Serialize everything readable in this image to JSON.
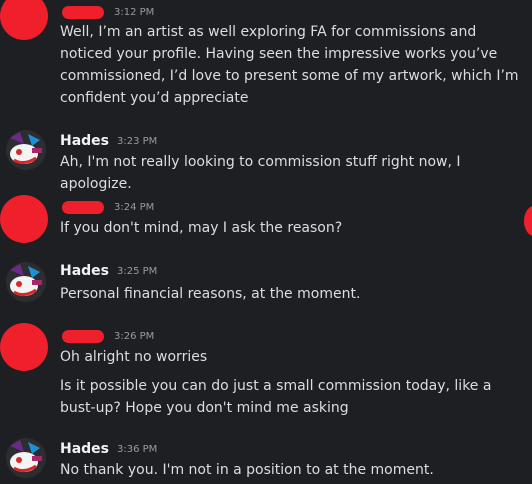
{
  "messages": [
    {
      "author": "",
      "time": "3:12 PM",
      "lines": [
        "Well, I’m an artist as well exploring FA for commissions and noticed your profile. Having seen the impressive works you’ve commissioned, I’d love to present some of my artwork, which I’m confident you’d appreciate"
      ]
    },
    {
      "author": "Hades",
      "time": "3:23 PM",
      "lines": [
        "Ah, I'm not really looking to commission stuff right now, I apologize."
      ]
    },
    {
      "author": "",
      "time": "3:24 PM",
      "lines": [
        "If you don't mind, may I ask the reason?"
      ]
    },
    {
      "author": "Hades",
      "time": "3:25 PM",
      "lines": [
        "Personal financial reasons, at the moment."
      ]
    },
    {
      "author": "",
      "time": "3:26 PM",
      "lines": [
        "Oh alright no worries",
        "Is it possible you can do just a small commission today, like a bust-up? Hope you don't mind me asking"
      ]
    },
    {
      "author": "Hades",
      "time": "3:36 PM",
      "lines": [
        "No thank you. I'm not in a position to at the moment."
      ]
    }
  ],
  "colors": {
    "background": "#1e1f22",
    "redaction": "#ef1f2c",
    "username": "#f2f3f5",
    "message_text": "#dbdee1",
    "timestamp": "#949ba4"
  },
  "icons": {
    "hades_avatar": "hades-avatar-icon",
    "redacted_avatar": "redacted-avatar-icon"
  }
}
